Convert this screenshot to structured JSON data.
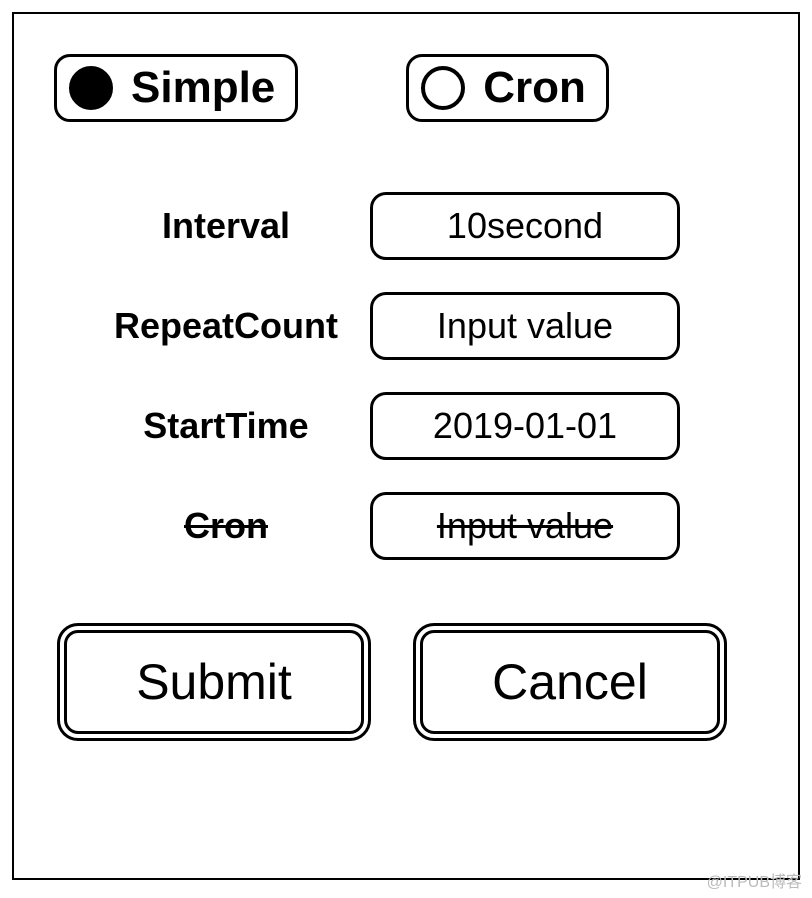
{
  "radios": {
    "simple": {
      "label": "Simple",
      "selected": true
    },
    "cron": {
      "label": "Cron",
      "selected": false
    }
  },
  "fields": {
    "interval": {
      "label": "Interval",
      "value": "10second",
      "disabled": false
    },
    "repeatCount": {
      "label": "RepeatCount",
      "value": "Input value",
      "disabled": false
    },
    "startTime": {
      "label": "StartTime",
      "value": "2019-01-01",
      "disabled": false
    },
    "cron": {
      "label": "Cron",
      "value": "Input value",
      "disabled": true
    }
  },
  "buttons": {
    "submit": "Submit",
    "cancel": "Cancel"
  },
  "watermark": "@ITPUB博客"
}
